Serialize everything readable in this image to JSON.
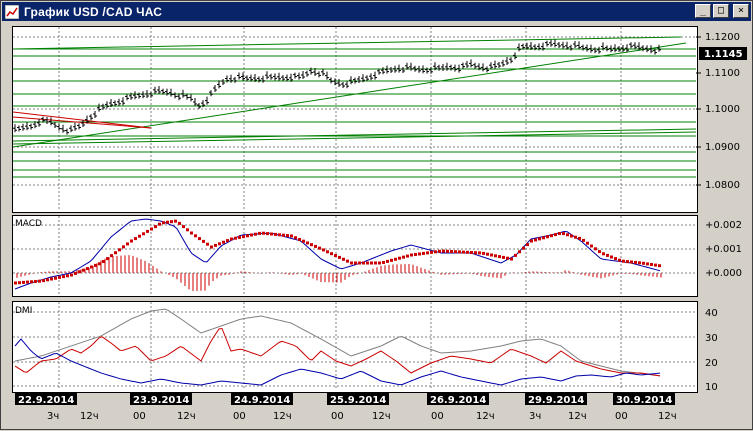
{
  "window": {
    "title": "График USD /CAD  ЧАС",
    "buttons": [
      "_",
      "□",
      "×"
    ]
  },
  "price_axis": {
    "ticks": [
      "1.1200",
      "1.1100",
      "1.1000",
      "1.0900",
      "1.0800"
    ],
    "current": "1.1145"
  },
  "macd": {
    "label": "MACD",
    "ticks": [
      "+0.002",
      "+0.001",
      "+0.000"
    ]
  },
  "dmi": {
    "label": "DMI",
    "ticks": [
      "40",
      "30",
      "20",
      "10"
    ]
  },
  "dates": [
    "22.9.2014",
    "23.9.2014",
    "24.9.2014",
    "25.9.2014",
    "26.9.2014",
    "29.9.2014",
    "30.9.2014"
  ],
  "hours": [
    "3ч",
    "12ч",
    "00",
    "12ч",
    "00",
    "12ч",
    "00",
    "12ч",
    "00",
    "12ч",
    "3ч",
    "12ч",
    "00",
    "12ч"
  ],
  "colors": {
    "title_bg": "#0a246a",
    "signal_line": "#cc0000",
    "macd_line": "#0000aa",
    "trend_line": "#008000",
    "histogram": "#cc0000"
  }
}
